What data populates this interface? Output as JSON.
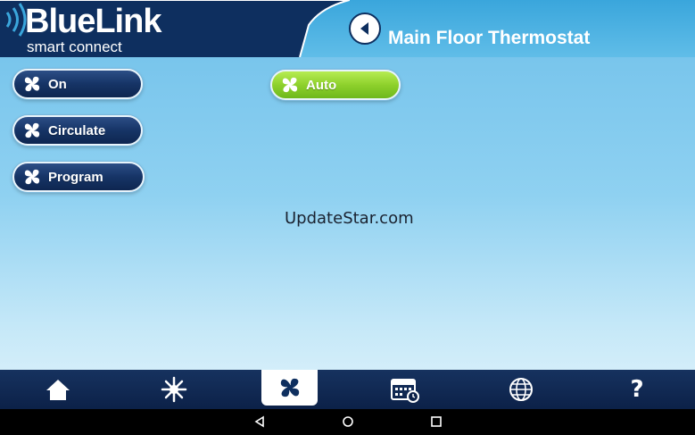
{
  "header": {
    "logo_text": "BlueLink",
    "logo_tagline": "smart connect",
    "title": "Main Floor Thermostat"
  },
  "modes": [
    {
      "label": "On",
      "active": false
    },
    {
      "label": "Circulate",
      "active": false
    },
    {
      "label": "Program",
      "active": false
    },
    {
      "label": "Auto",
      "active": true
    }
  ],
  "watermark": "UpdateStar.com",
  "nav": {
    "items": [
      {
        "icon": "home-icon"
      },
      {
        "icon": "snowflake-sun-icon"
      },
      {
        "icon": "fan-icon",
        "selected": true
      },
      {
        "icon": "calendar-clock-icon"
      },
      {
        "icon": "globe-icon"
      },
      {
        "icon": "help-icon",
        "glyph": "?"
      }
    ]
  },
  "android": {
    "keys": [
      "back-icon",
      "home-circle-icon",
      "recents-icon"
    ]
  },
  "colors": {
    "header_dark": "#0e2f5f",
    "sky_top": "#6fc0ea",
    "active_green": "#8ed12c",
    "button_dark": "#163466",
    "nav_dark": "#0c2148"
  }
}
